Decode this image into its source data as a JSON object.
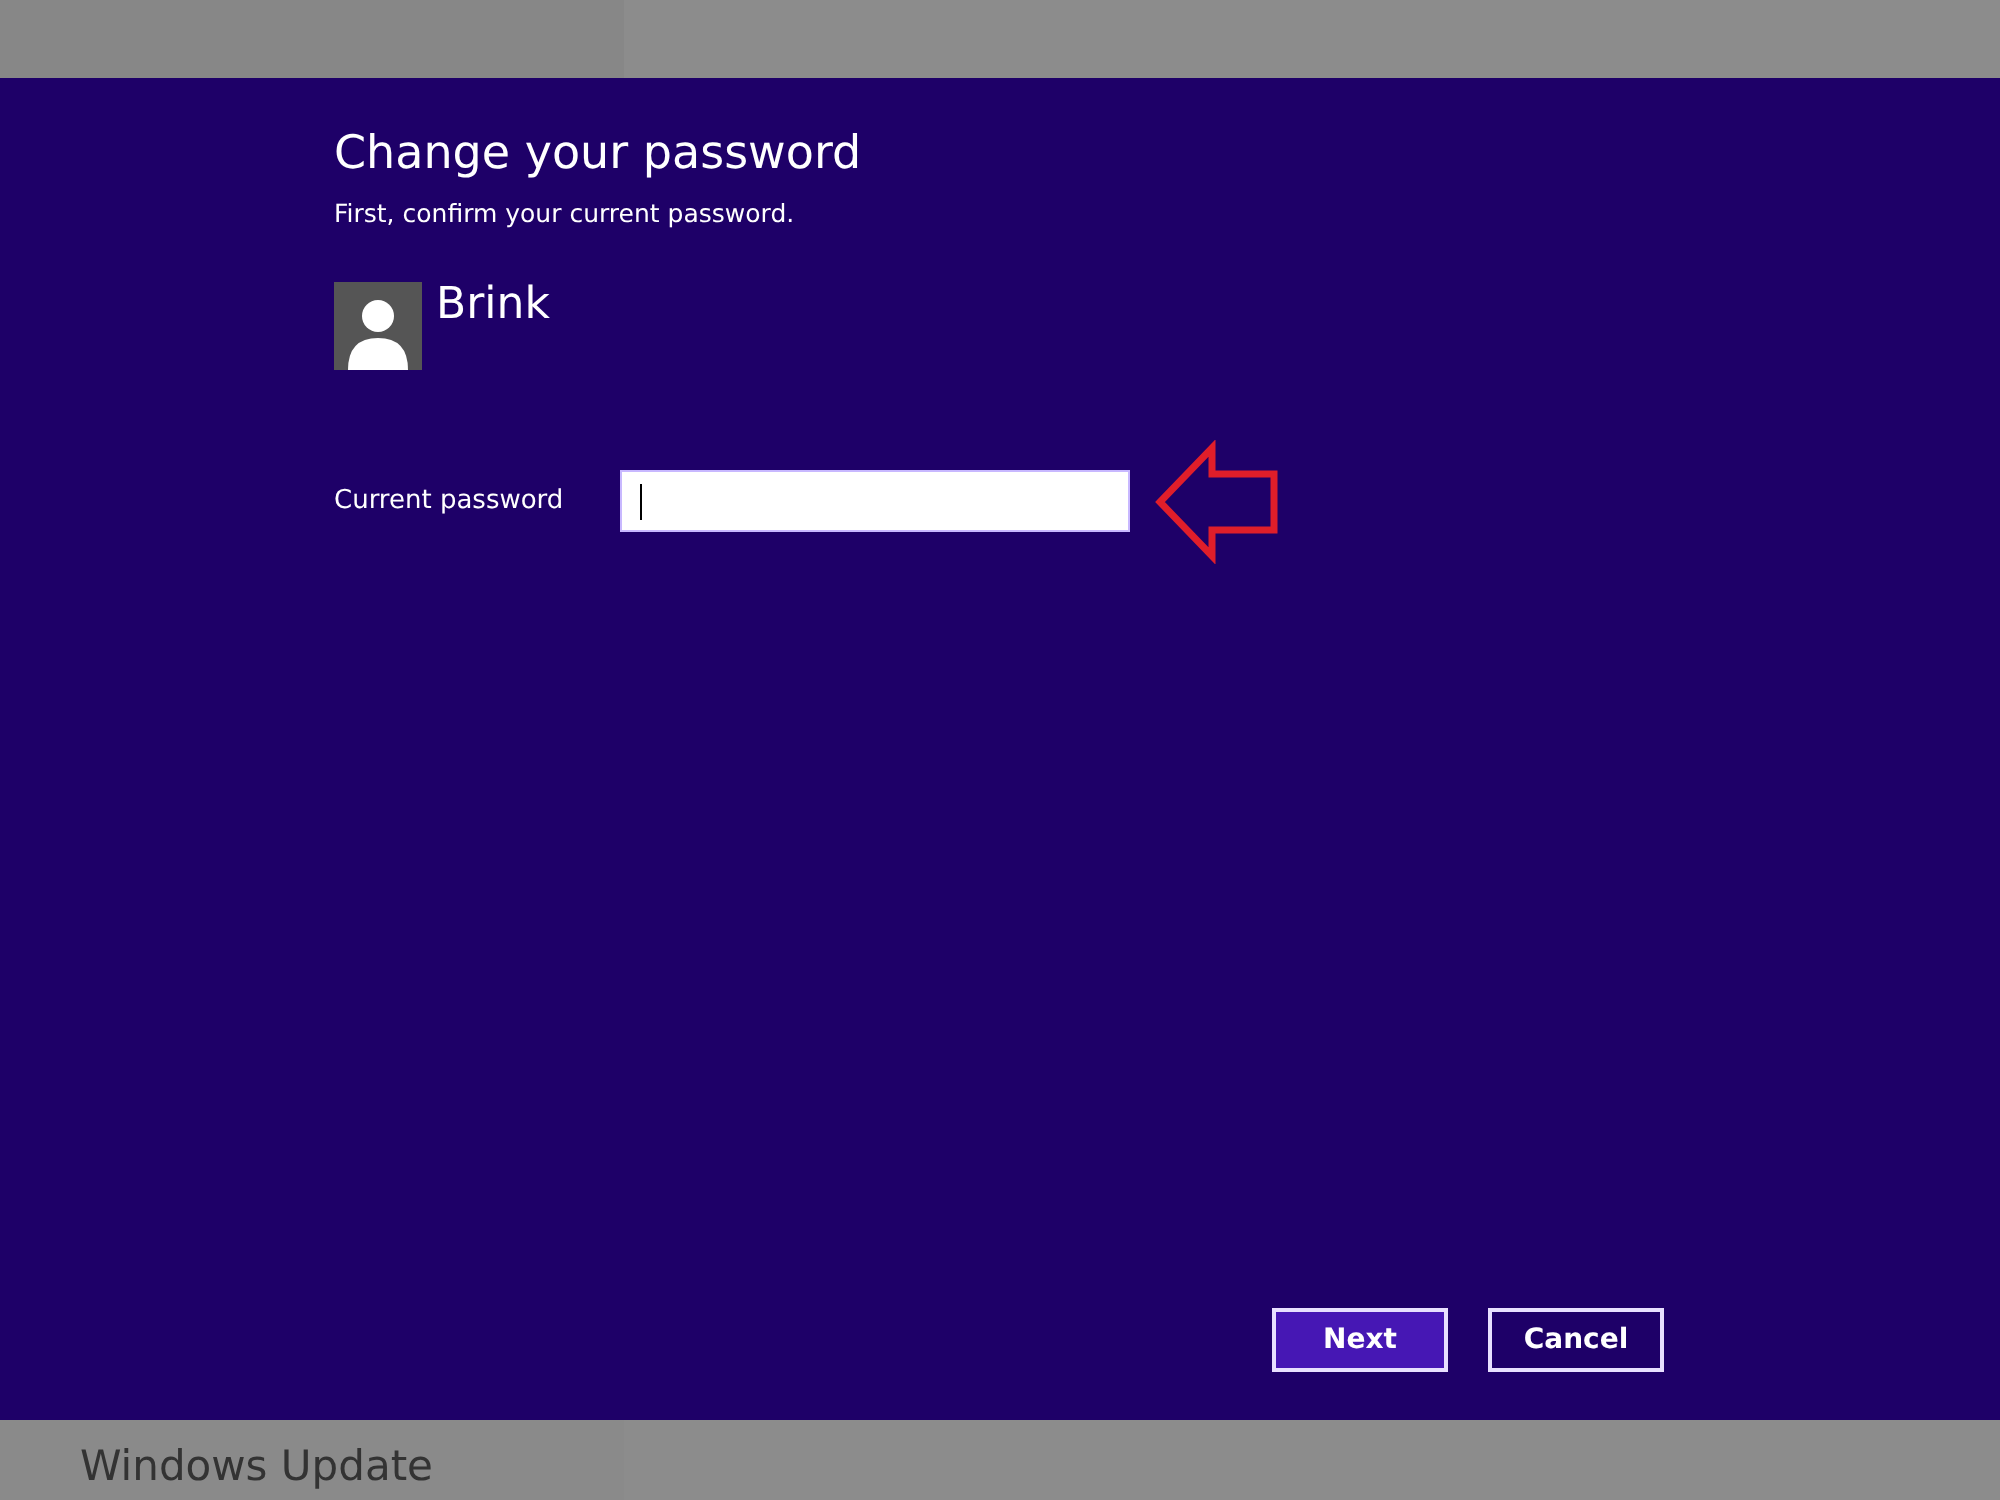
{
  "dialog": {
    "title": "Change your password",
    "subtitle": "First, confirm your current password.",
    "user": {
      "name": "Brink"
    },
    "field": {
      "label": "Current password",
      "focused": true
    },
    "annotation": {
      "kind": "arrow-left"
    },
    "buttons": [
      {
        "label": "Next",
        "kind": "primary"
      },
      {
        "label": "Cancel",
        "kind": "secondary"
      }
    ]
  },
  "background": {
    "title": "Windows Update"
  }
}
